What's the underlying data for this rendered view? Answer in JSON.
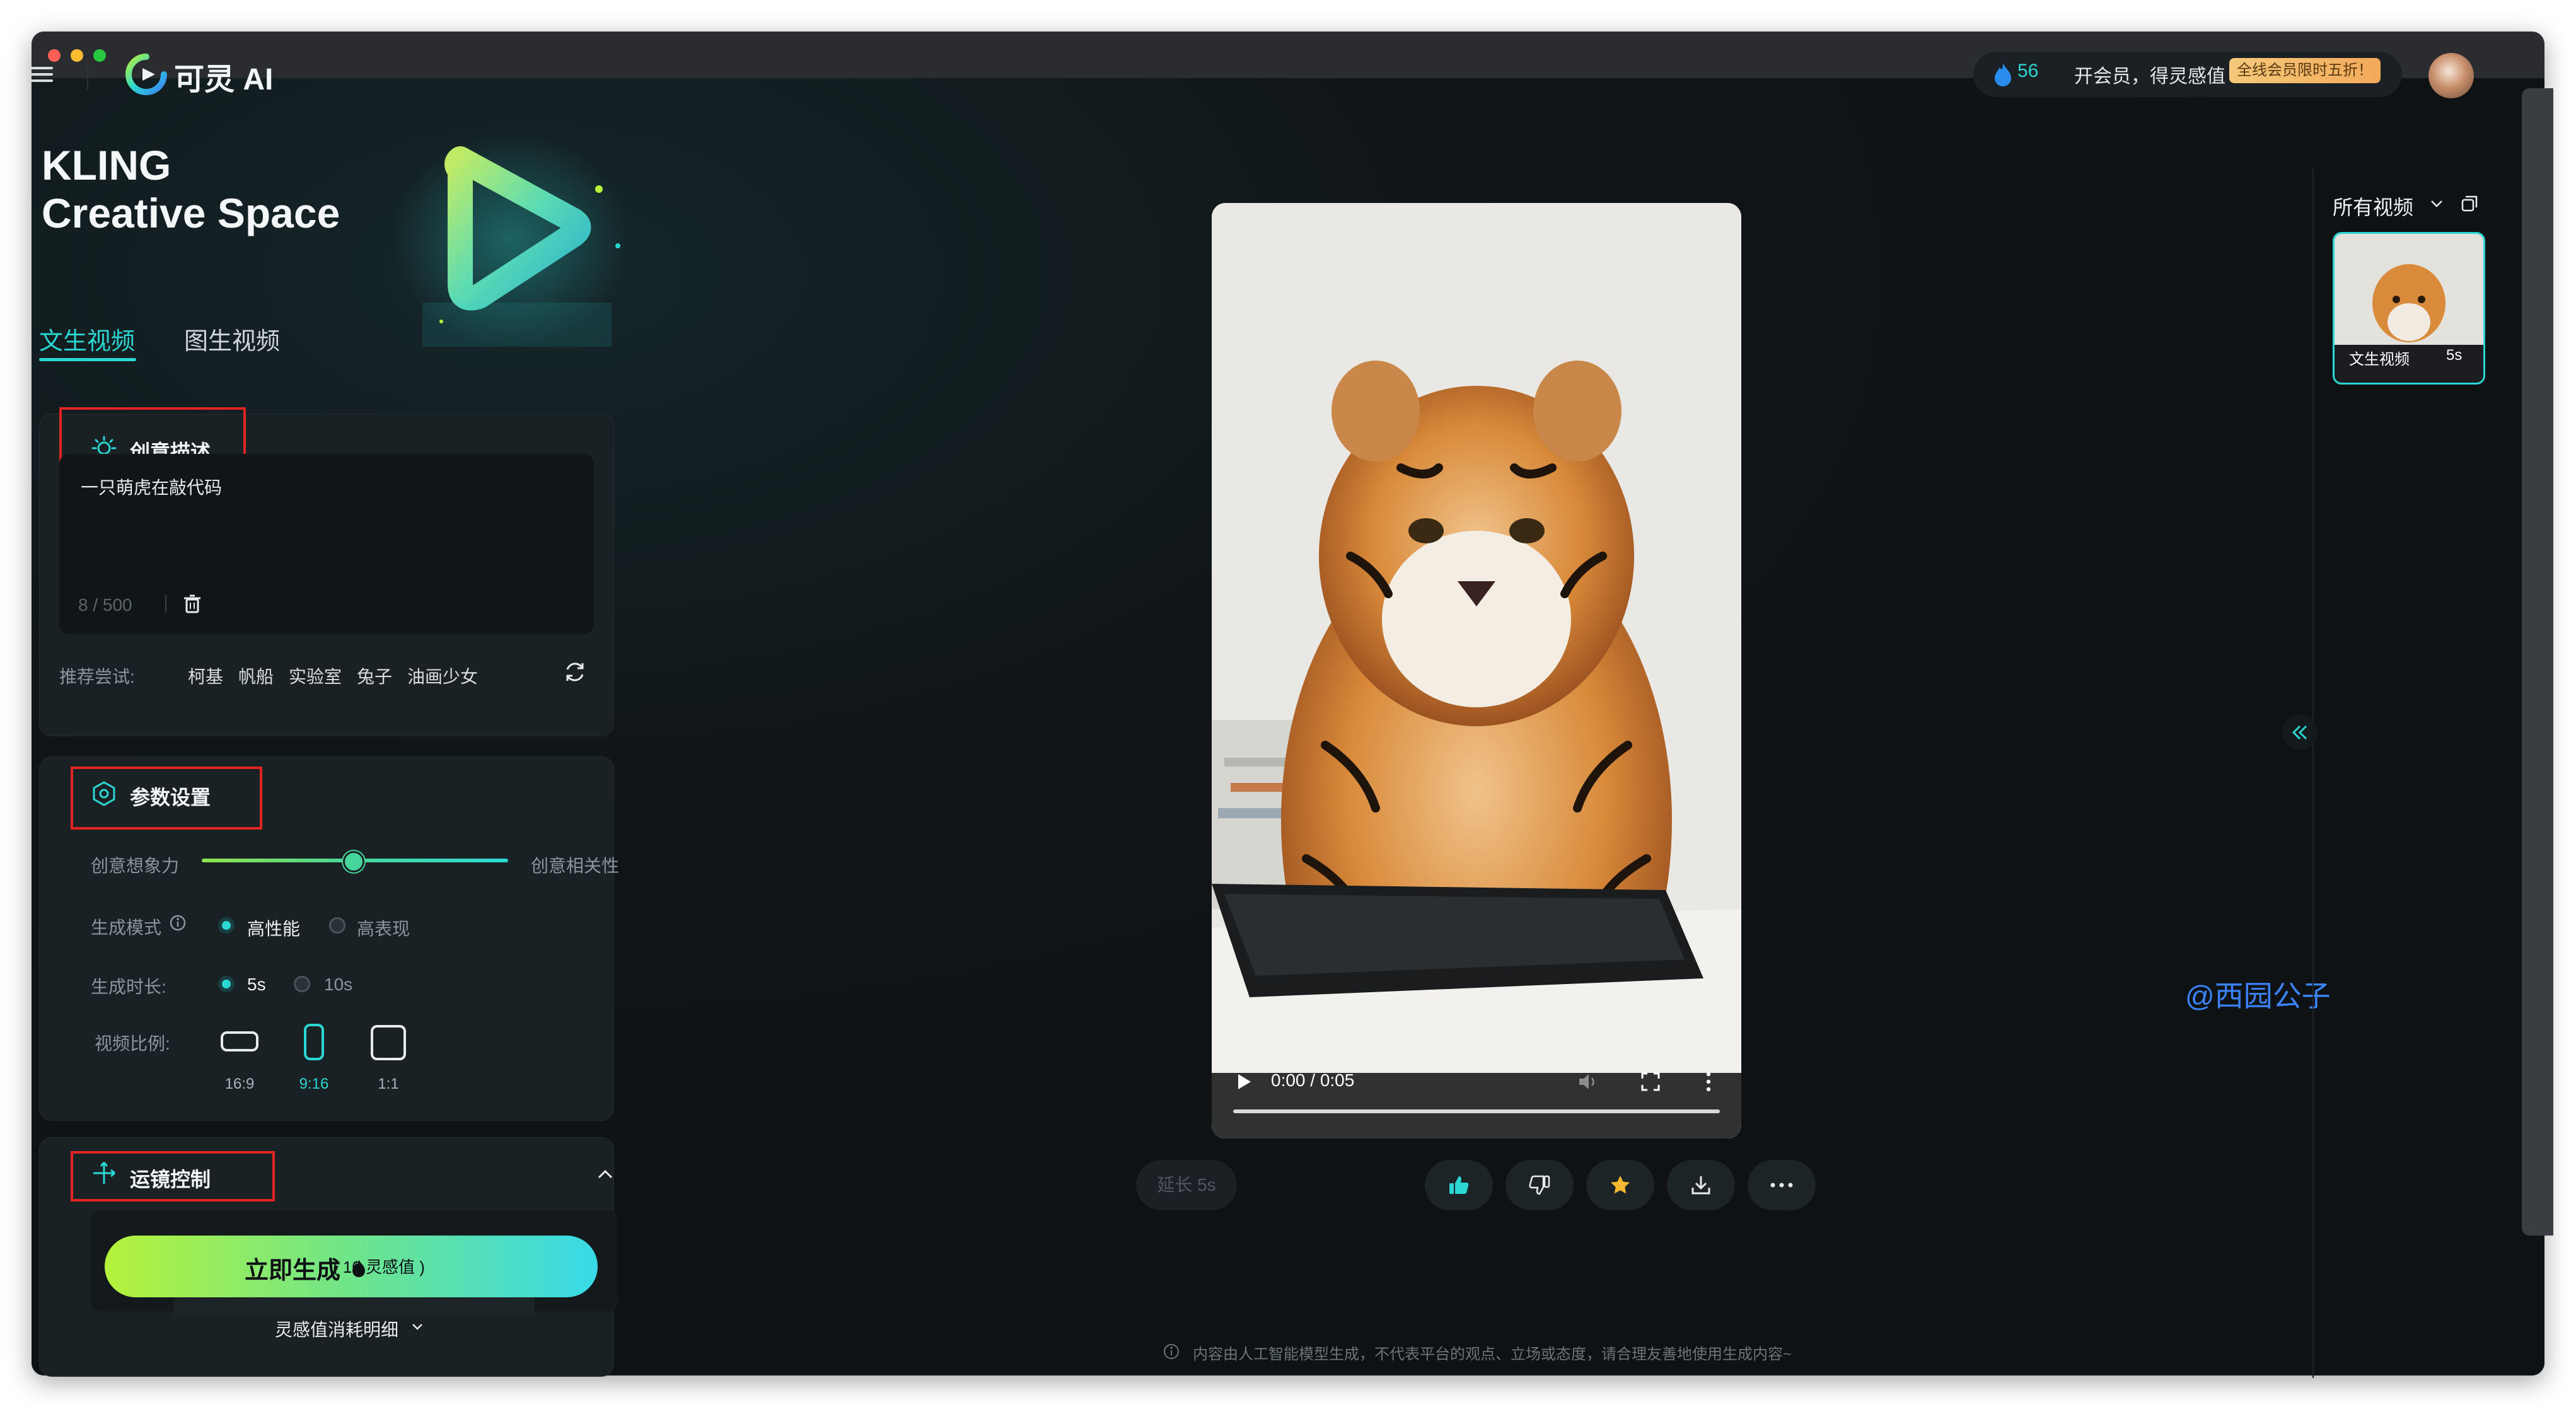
{
  "header": {
    "brand": "可灵 AI",
    "points": "56",
    "vip_text": "开会员，得灵感值",
    "vip_badge": "全线会员限时五折！"
  },
  "hero": {
    "title_line1": "KLING",
    "title_line2": "Creative Space"
  },
  "tabs": [
    {
      "label": "文生视频",
      "active": true
    },
    {
      "label": "图生视频",
      "active": false
    }
  ],
  "prompt_section": {
    "title": "创意描述",
    "text": "一只萌虎在敲代码",
    "counter": "8 / 500",
    "suggest_label": "推荐尝试:",
    "suggestions": [
      "柯基",
      "帆船",
      "实验室",
      "兔子",
      "油画少女"
    ]
  },
  "params_section": {
    "title": "参数设置",
    "slider_left": "创意想象力",
    "slider_right": "创意相关性",
    "slider_value": 0.5,
    "mode_label": "生成模式",
    "mode_options": [
      "高性能",
      "高表现"
    ],
    "mode_selected": "高性能",
    "duration_label": "生成时长:",
    "duration_options": [
      "5s",
      "10s"
    ],
    "duration_selected": "5s",
    "ratio_label": "视频比例:",
    "ratios": [
      "16:9",
      "9:16",
      "1:1"
    ],
    "ratio_selected": "9:16"
  },
  "camera_section": {
    "title": "运镜控制"
  },
  "generate": {
    "label": "立即生成",
    "cost": "(  10 灵感值  )",
    "cost_detail": "灵感值消耗明细"
  },
  "video": {
    "time": "0:00 / 0:05",
    "extend_label": "延长 5s"
  },
  "watermark": "@西园公子",
  "footer_note": "内容由人工智能模型生成，不代表平台的观点、立场或态度，请合理友善地使用生成内容~",
  "rail": {
    "title": "所有视频",
    "thumb_caption": "文生视频",
    "thumb_duration": "5s"
  },
  "colors": {
    "accent": "#2bd7d2",
    "highlight_box": "#e22424"
  }
}
